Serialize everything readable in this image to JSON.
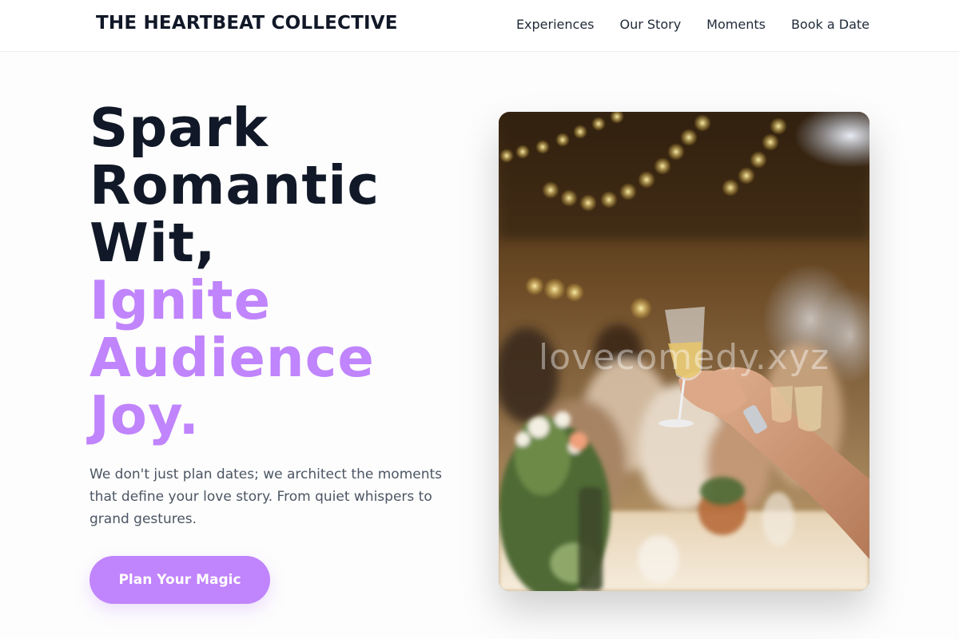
{
  "header": {
    "brand": "THE HEARTBEAT COLLECTIVE",
    "nav": [
      {
        "label": "Experiences"
      },
      {
        "label": "Our Story"
      },
      {
        "label": "Moments"
      },
      {
        "label": "Book a Date"
      }
    ]
  },
  "hero": {
    "title_lines_dark": [
      "Spark",
      "Romantic",
      "Wit,"
    ],
    "title_lines_accent": [
      "Ignite",
      "Audience",
      "Joy."
    ],
    "subtitle": "We don't just plan dates; we architect the moments that define your love story. From quiet whispers to grand gestures.",
    "cta_label": "Plan Your Magic"
  },
  "image": {
    "watermark": "lovecomedy.xyz"
  },
  "colors": {
    "accent": "#c084fc",
    "heading": "#111827",
    "body_text": "#4b5563"
  }
}
